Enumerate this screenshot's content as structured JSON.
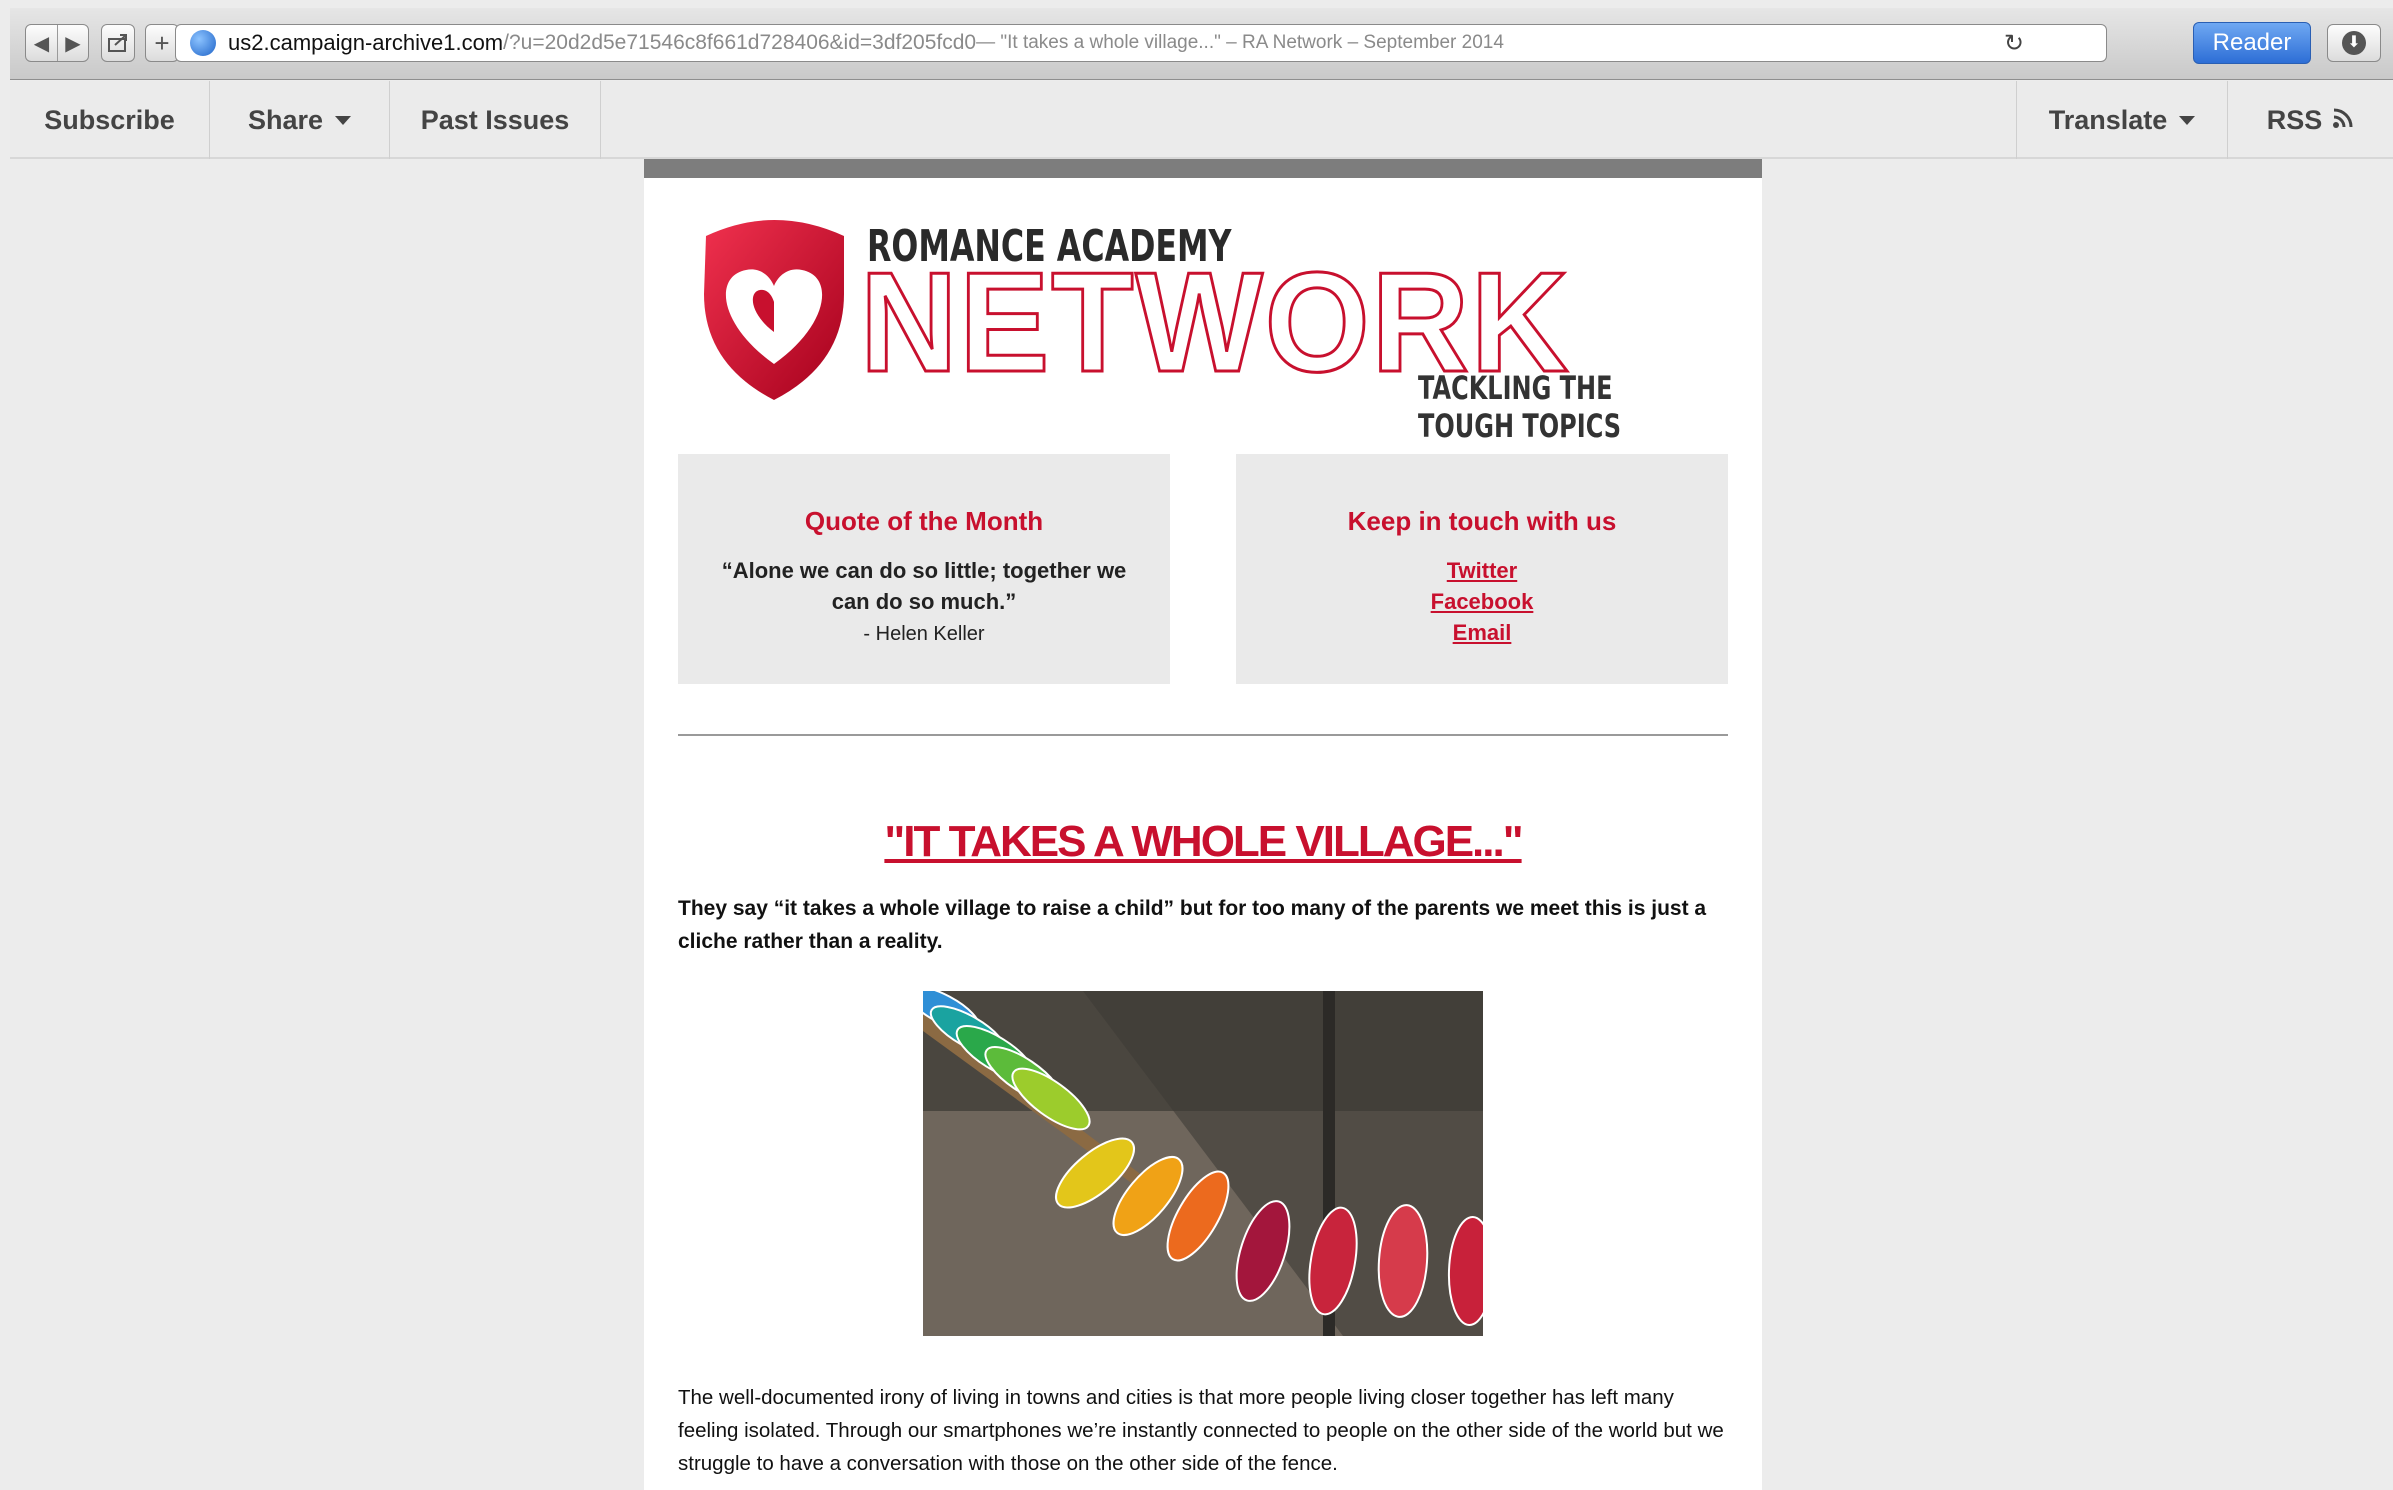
{
  "browser": {
    "url_host": "us2.campaign-archive1.com",
    "url_path": "/?u=20d2d5e71546c8f661d728406&id=3df205fcd0",
    "page_title": " — \"It takes a whole village...\" – RA Network – September 2014",
    "reader_label": "Reader"
  },
  "nav": {
    "subscribe": "Subscribe",
    "share": "Share",
    "past_issues": "Past Issues",
    "translate": "Translate",
    "rss": "RSS"
  },
  "logo": {
    "academy": "ROMANCE ACADEMY",
    "network": "NETWORK",
    "tagline": "TACKLING THE TOUGH TOPICS"
  },
  "quote_box": {
    "heading": "Quote of the Month",
    "quote": "“Alone we can do so little; together we can do so much.”",
    "author": "- Helen Keller"
  },
  "contact_box": {
    "heading": "Keep in touch with us",
    "links": [
      "Twitter",
      "Facebook",
      "Email"
    ]
  },
  "article": {
    "title": "\"IT TAKES A WHOLE VILLAGE...\"",
    "intro": "They say “it takes a whole village to raise a child” but for too many of the parents we meet this is just a cliche rather than a reality.",
    "body": "The well-documented irony of living in towns and cities is that more people living closer together has left many feeling isolated. Through our smartphones we’re instantly connected to people on the other side of the world but we struggle to have a conversation with those on the other side of the fence."
  },
  "colors": {
    "brand_red": "#c8102e",
    "reader_blue": "#2d6ed6",
    "box_gray": "#eaeaea"
  },
  "icons": [
    "back-icon",
    "forward-icon",
    "share-sheet-icon",
    "add-bookmark-icon",
    "globe-icon",
    "reload-icon",
    "download-icon",
    "rss-icon",
    "shield-heart-icon"
  ]
}
